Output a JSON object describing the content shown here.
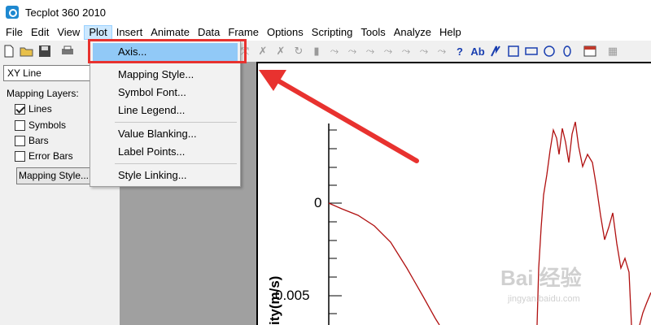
{
  "window": {
    "title": "Tecplot 360 2010"
  },
  "menubar": [
    "File",
    "Edit",
    "View",
    "Plot",
    "Insert",
    "Animate",
    "Data",
    "Frame",
    "Options",
    "Scripting",
    "Tools",
    "Analyze",
    "Help"
  ],
  "toolbar": {
    "text_tool": "Ab"
  },
  "sidebar": {
    "plot_type": "XY Line",
    "mapping_layers_label": "Mapping Layers:",
    "layers": [
      {
        "label": "Lines",
        "checked": true
      },
      {
        "label": "Symbols",
        "checked": false
      },
      {
        "label": "Bars",
        "checked": false
      },
      {
        "label": "Error Bars",
        "checked": false
      }
    ],
    "mapping_style_button": "Mapping Style..."
  },
  "plot_menu": {
    "items": [
      "Axis...",
      "Mapping Style...",
      "Symbol Font...",
      "Line Legend...",
      "Value Blanking...",
      "Label Points...",
      "Style Linking..."
    ],
    "highlighted": "Axis..."
  },
  "plot": {
    "y_ticks": [
      "0",
      "0.005"
    ],
    "y_title_visible": "ity(m/s)",
    "line_color": "#b01010"
  },
  "watermark": {
    "text": "Bai 经验",
    "sub": "jingyan.baidu.com"
  },
  "colors": {
    "highlight": "#91c9f7",
    "annotation": "#e8322f",
    "menu_active": "#cce8ff"
  }
}
